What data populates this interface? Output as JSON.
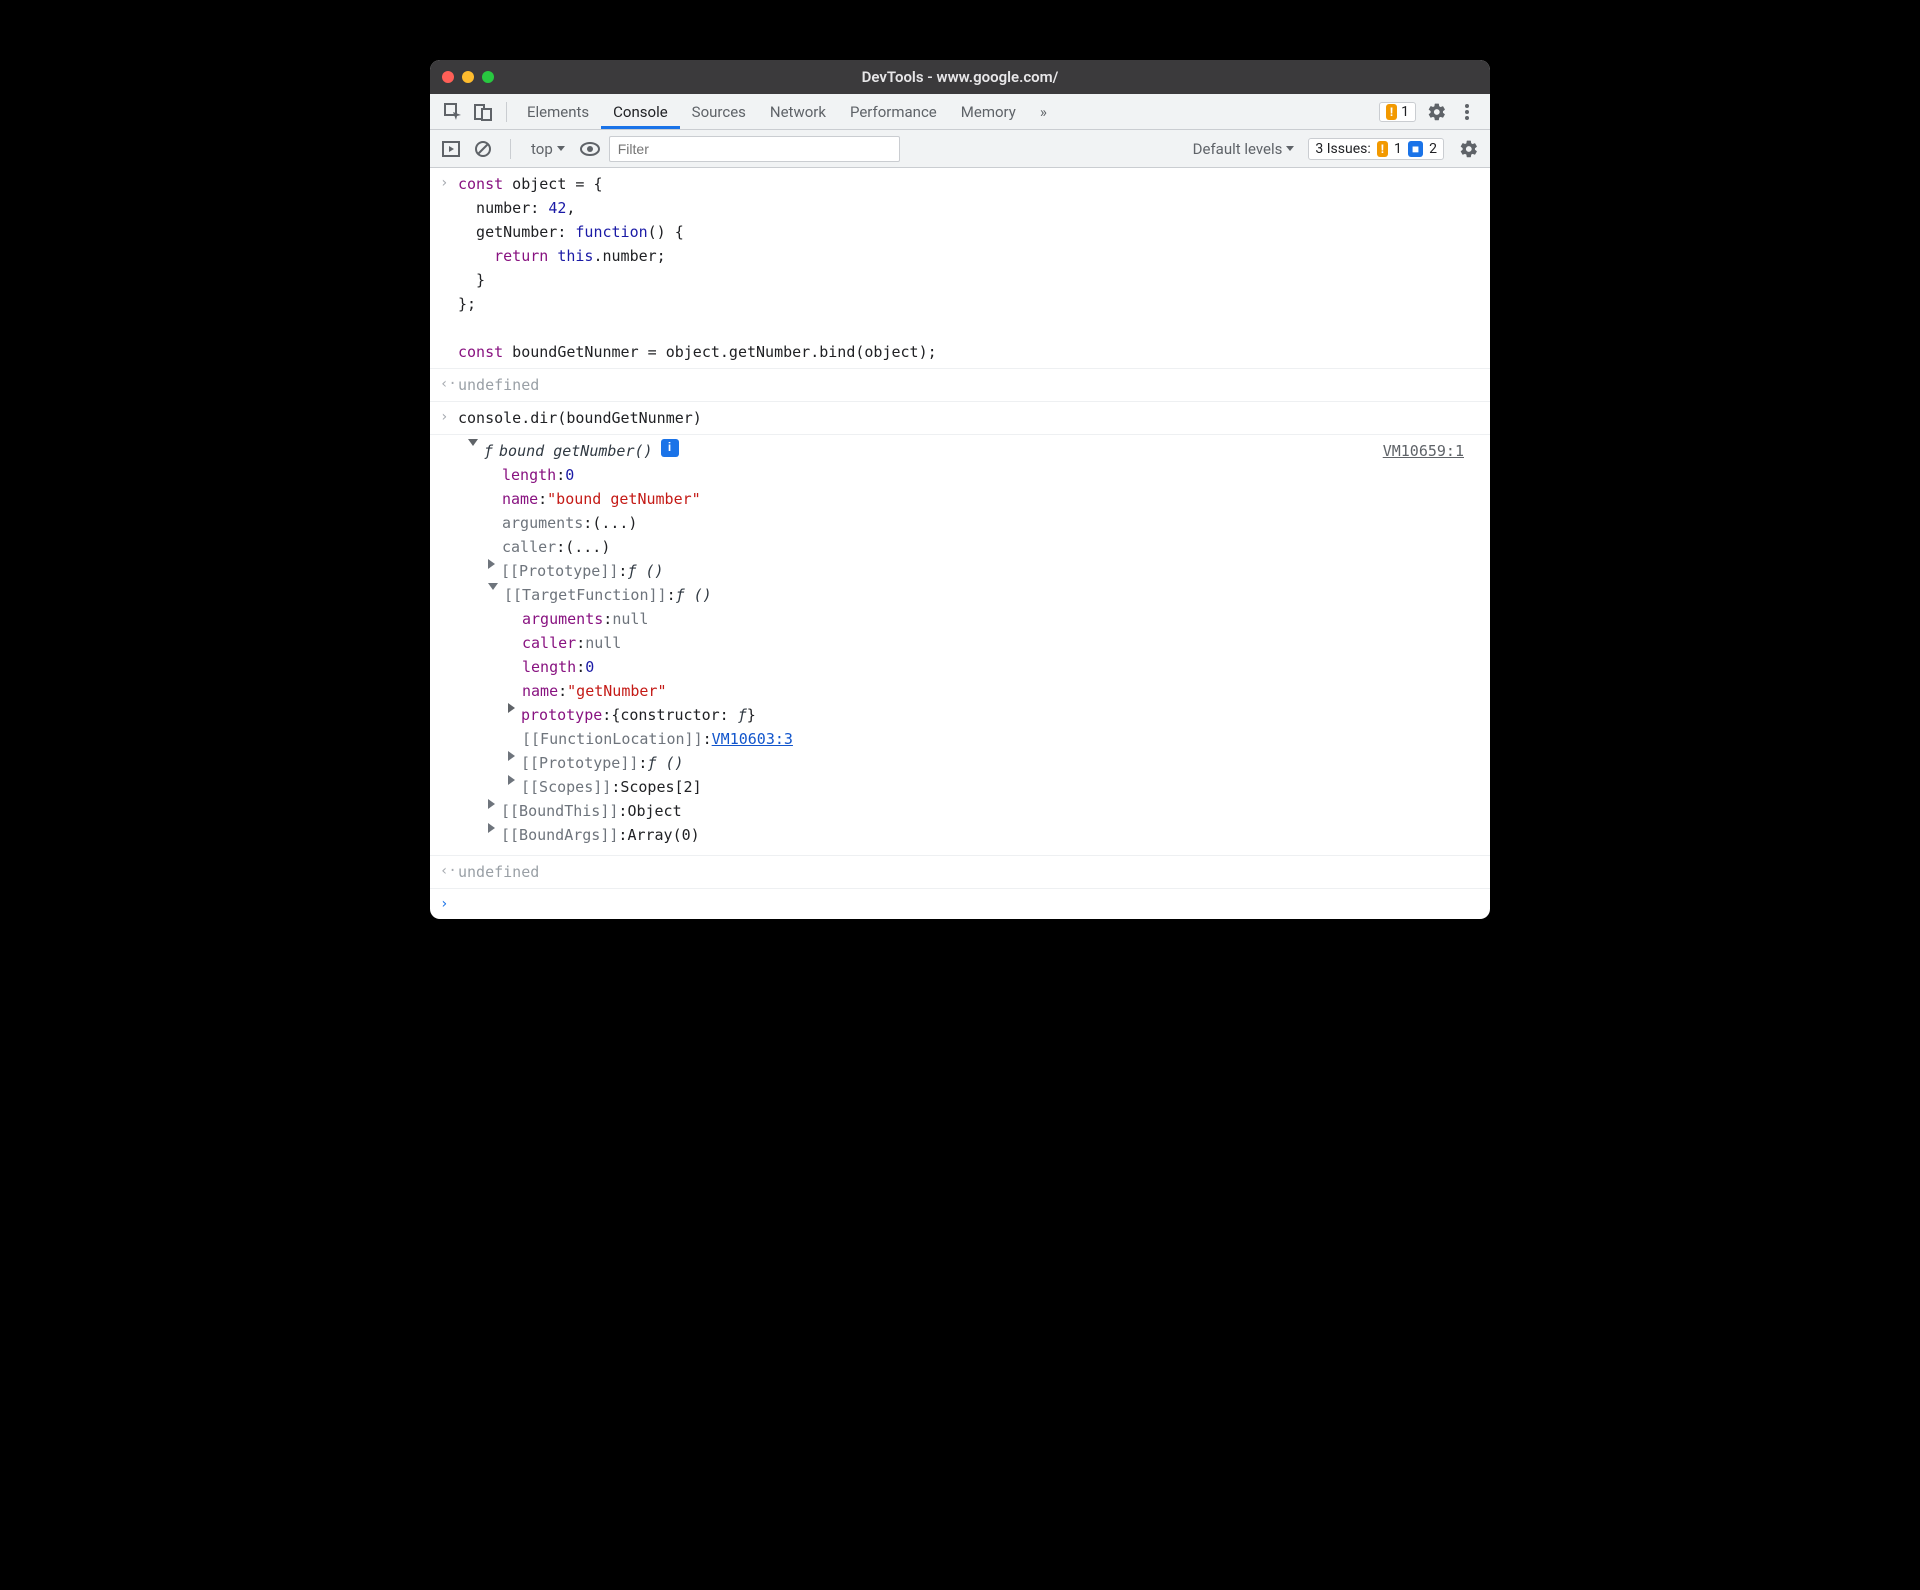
{
  "titlebar": {
    "title": "DevTools - www.google.com/"
  },
  "tabs": {
    "elements": "Elements",
    "console": "Console",
    "sources": "Sources",
    "network": "Network",
    "performance": "Performance",
    "memory": "Memory",
    "more": "»",
    "warn_count": "1"
  },
  "toolbar": {
    "context": "top",
    "filter_placeholder": "Filter",
    "levels": "Default levels",
    "issues_label": "3 Issues:",
    "issues_warn": "1",
    "issues_info": "2"
  },
  "code": {
    "input1": "const object = {\n  number: 42,\n  getNumber: function() {\n    return this.number;\n  }\n};\n\nconst boundGetNunmer = object.getNumber.bind(object);",
    "result1": "undefined",
    "input2": "console.dir(boundGetNunmer)",
    "source_link": "VM10659:1",
    "result2": "undefined"
  },
  "dir": {
    "header_f": "ƒ",
    "header_name": "bound getNumber()",
    "length_k": "length",
    "length_v": "0",
    "name_k": "name",
    "name_v": "\"bound getNumber\"",
    "arguments_k": "arguments",
    "arguments_v": "(...)",
    "caller_k": "caller",
    "caller_v": "(...)",
    "proto_k": "[[Prototype]]",
    "proto_v": "ƒ ()",
    "target_k": "[[TargetFunction]]",
    "target_v": "ƒ ()",
    "t_arguments_k": "arguments",
    "t_arguments_v": "null",
    "t_caller_k": "caller",
    "t_caller_v": "null",
    "t_length_k": "length",
    "t_length_v": "0",
    "t_name_k": "name",
    "t_name_v": "\"getNumber\"",
    "t_prototype_k": "prototype",
    "t_prototype_v": "{constructor: ƒ}",
    "t_funcloc_k": "[[FunctionLocation]]",
    "t_funcloc_v": "VM10603:3",
    "t_proto_k": "[[Prototype]]",
    "t_proto_v": "ƒ ()",
    "t_scopes_k": "[[Scopes]]",
    "t_scopes_v": "Scopes[2]",
    "boundthis_k": "[[BoundThis]]",
    "boundthis_v": "Object",
    "boundargs_k": "[[BoundArgs]]",
    "boundargs_v": "Array(0)"
  }
}
